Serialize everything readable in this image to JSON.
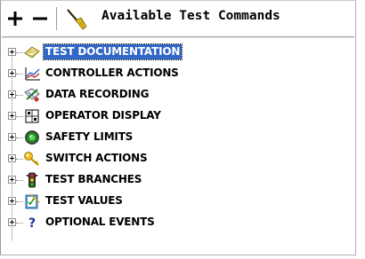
{
  "toolbar": {
    "plus_label": "+",
    "minus_label": "−",
    "title": "Available Test Commands"
  },
  "tree": {
    "items": [
      {
        "label": "TEST DOCUMENTATION",
        "icon": "document-icon",
        "selected": true
      },
      {
        "label": "CONTROLLER ACTIONS",
        "icon": "chart-icon"
      },
      {
        "label": "DATA RECORDING",
        "icon": "recorder-icon"
      },
      {
        "label": "OPERATOR DISPLAY",
        "icon": "display-icon"
      },
      {
        "label": "SAFETY LIMITS",
        "icon": "green-light-icon"
      },
      {
        "label": "SWITCH ACTIONS",
        "icon": "key-icon"
      },
      {
        "label": "TEST BRANCHES",
        "icon": "traffic-light-icon"
      },
      {
        "label": "TEST VALUES",
        "icon": "clipboard-icon"
      },
      {
        "label": "OPTIONAL EVENTS",
        "icon": "question-icon"
      }
    ]
  },
  "colors": {
    "selection": "#3166c7",
    "selection_text": "#ffffff"
  }
}
